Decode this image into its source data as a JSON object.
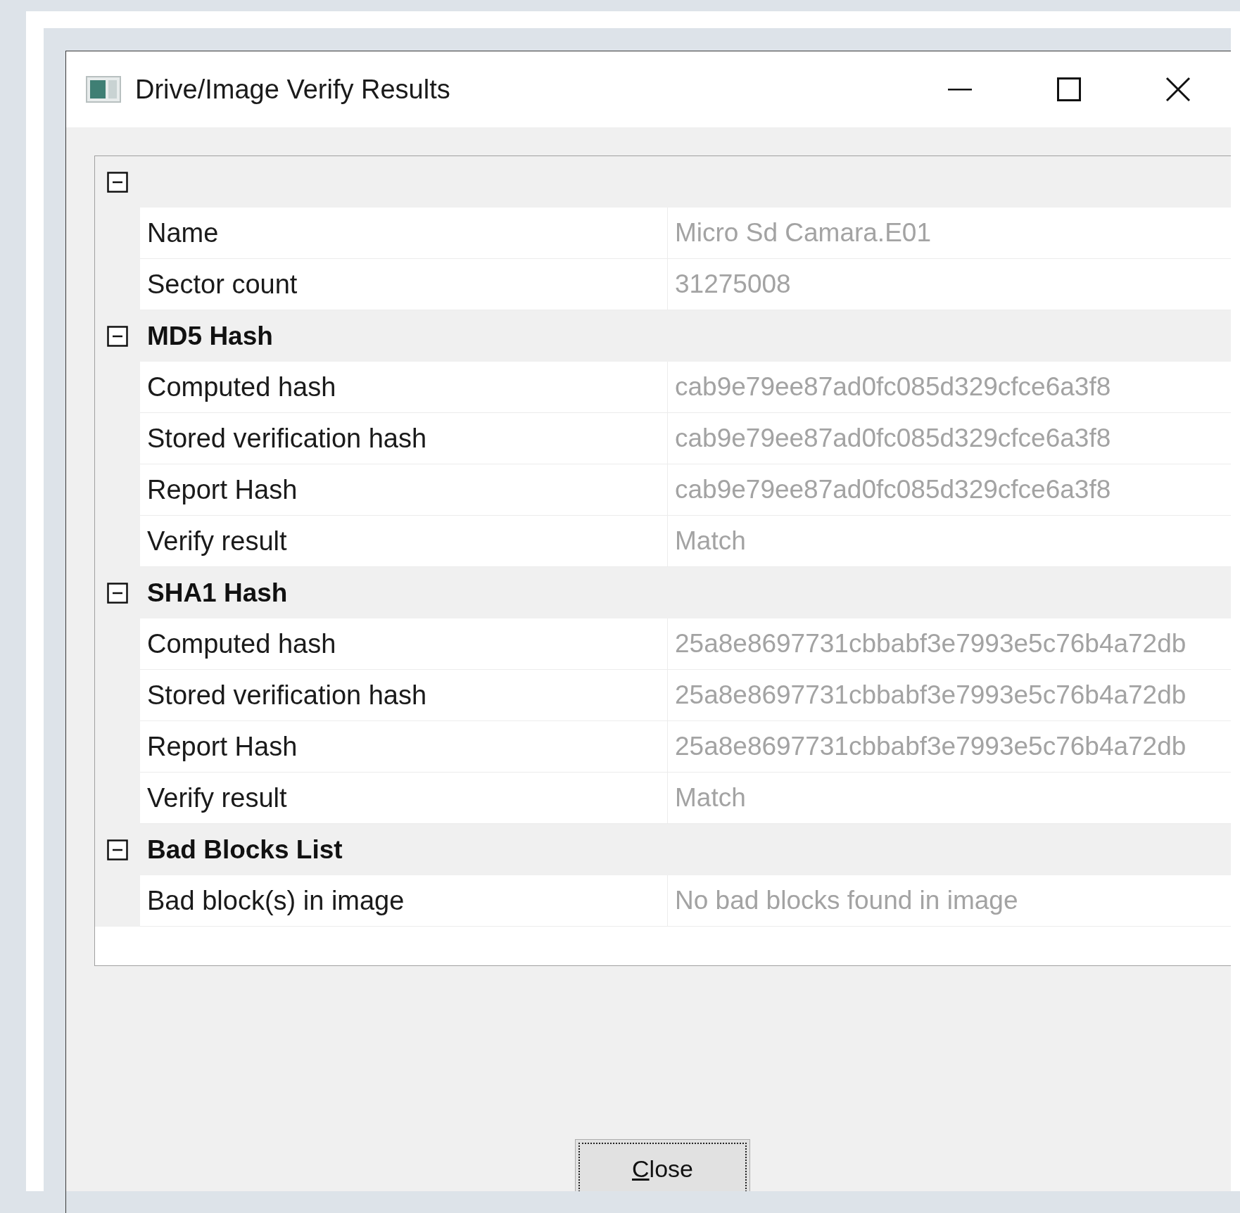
{
  "window": {
    "title": "Drive/Image Verify Results"
  },
  "groups": [
    {
      "expanded": true,
      "rows": [
        {
          "name": "Name",
          "value": "Micro Sd Camara.E01"
        },
        {
          "name": "Sector count",
          "value": "31275008"
        }
      ]
    },
    {
      "title": "MD5 Hash",
      "expanded": true,
      "rows": [
        {
          "name": "Computed hash",
          "value": "cab9e79ee87ad0fc085d329cfce6a3f8"
        },
        {
          "name": "Stored verification hash",
          "value": "cab9e79ee87ad0fc085d329cfce6a3f8"
        },
        {
          "name": "Report Hash",
          "value": "cab9e79ee87ad0fc085d329cfce6a3f8"
        },
        {
          "name": "Verify result",
          "value": "Match"
        }
      ]
    },
    {
      "title": "SHA1 Hash",
      "expanded": true,
      "rows": [
        {
          "name": "Computed hash",
          "value": "25a8e8697731cbbabf3e7993e5c76b4a72db"
        },
        {
          "name": "Stored verification hash",
          "value": "25a8e8697731cbbabf3e7993e5c76b4a72db"
        },
        {
          "name": "Report Hash",
          "value": "25a8e8697731cbbabf3e7993e5c76b4a72db"
        },
        {
          "name": "Verify result",
          "value": "Match"
        }
      ]
    },
    {
      "title": "Bad Blocks List",
      "expanded": true,
      "rows": [
        {
          "name": "Bad block(s) in image",
          "value": "No bad blocks found in image"
        }
      ]
    }
  ],
  "buttons": [
    {
      "label": "Close",
      "focused": true,
      "mnemonic": true
    }
  ]
}
